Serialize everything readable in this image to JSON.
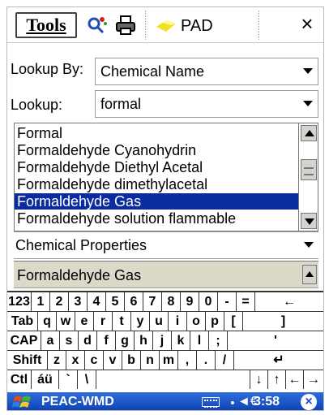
{
  "toolbar": {
    "tools_label": "Tools",
    "pad_label": "PAD",
    "close_label": "×",
    "icons": [
      "search-icon",
      "printer-icon",
      "pad-icon"
    ]
  },
  "lookup_by": {
    "label": "Lookup By:",
    "value": "Chemical Name"
  },
  "lookup": {
    "label": "Lookup:",
    "value": "formal"
  },
  "results": {
    "items": [
      "Formal",
      "Formaldehyde Cyanohydrin",
      "Formaldehyde Diethyl Acetal",
      "Formaldehyde dimethylacetal",
      "Formaldehyde Gas",
      "Formaldehyde solution flammable"
    ],
    "selected_index": 4
  },
  "properties": {
    "value": "Chemical Properties"
  },
  "detail": {
    "value": "Formaldehyde Gas"
  },
  "keyboard": {
    "rows": [
      [
        "123",
        "1",
        "2",
        "3",
        "4",
        "5",
        "6",
        "7",
        "8",
        "9",
        "0",
        "-",
        "=",
        "←"
      ],
      [
        "Tab",
        "q",
        "w",
        "e",
        "r",
        "t",
        "y",
        "u",
        "i",
        "o",
        "p",
        "[",
        "]"
      ],
      [
        "CAP",
        "a",
        "s",
        "d",
        "f",
        "g",
        "h",
        "j",
        "k",
        "l",
        ";",
        "'"
      ],
      [
        "Shift",
        "z",
        "x",
        "c",
        "v",
        "b",
        "n",
        "m",
        ",",
        ".",
        "/",
        "↵"
      ],
      [
        "Ctl",
        "áü",
        "`",
        "\\",
        "",
        "↓",
        "↑",
        "←",
        "→"
      ]
    ]
  },
  "taskbar": {
    "title": "PEAC-WMD",
    "volume_glyph": "◄€",
    "time": "3:58",
    "close_label": "×"
  },
  "colors": {
    "selection": "#0a2c9e",
    "taskbar": "#1d4fc0",
    "detail_bg": "#ddd9c8"
  }
}
